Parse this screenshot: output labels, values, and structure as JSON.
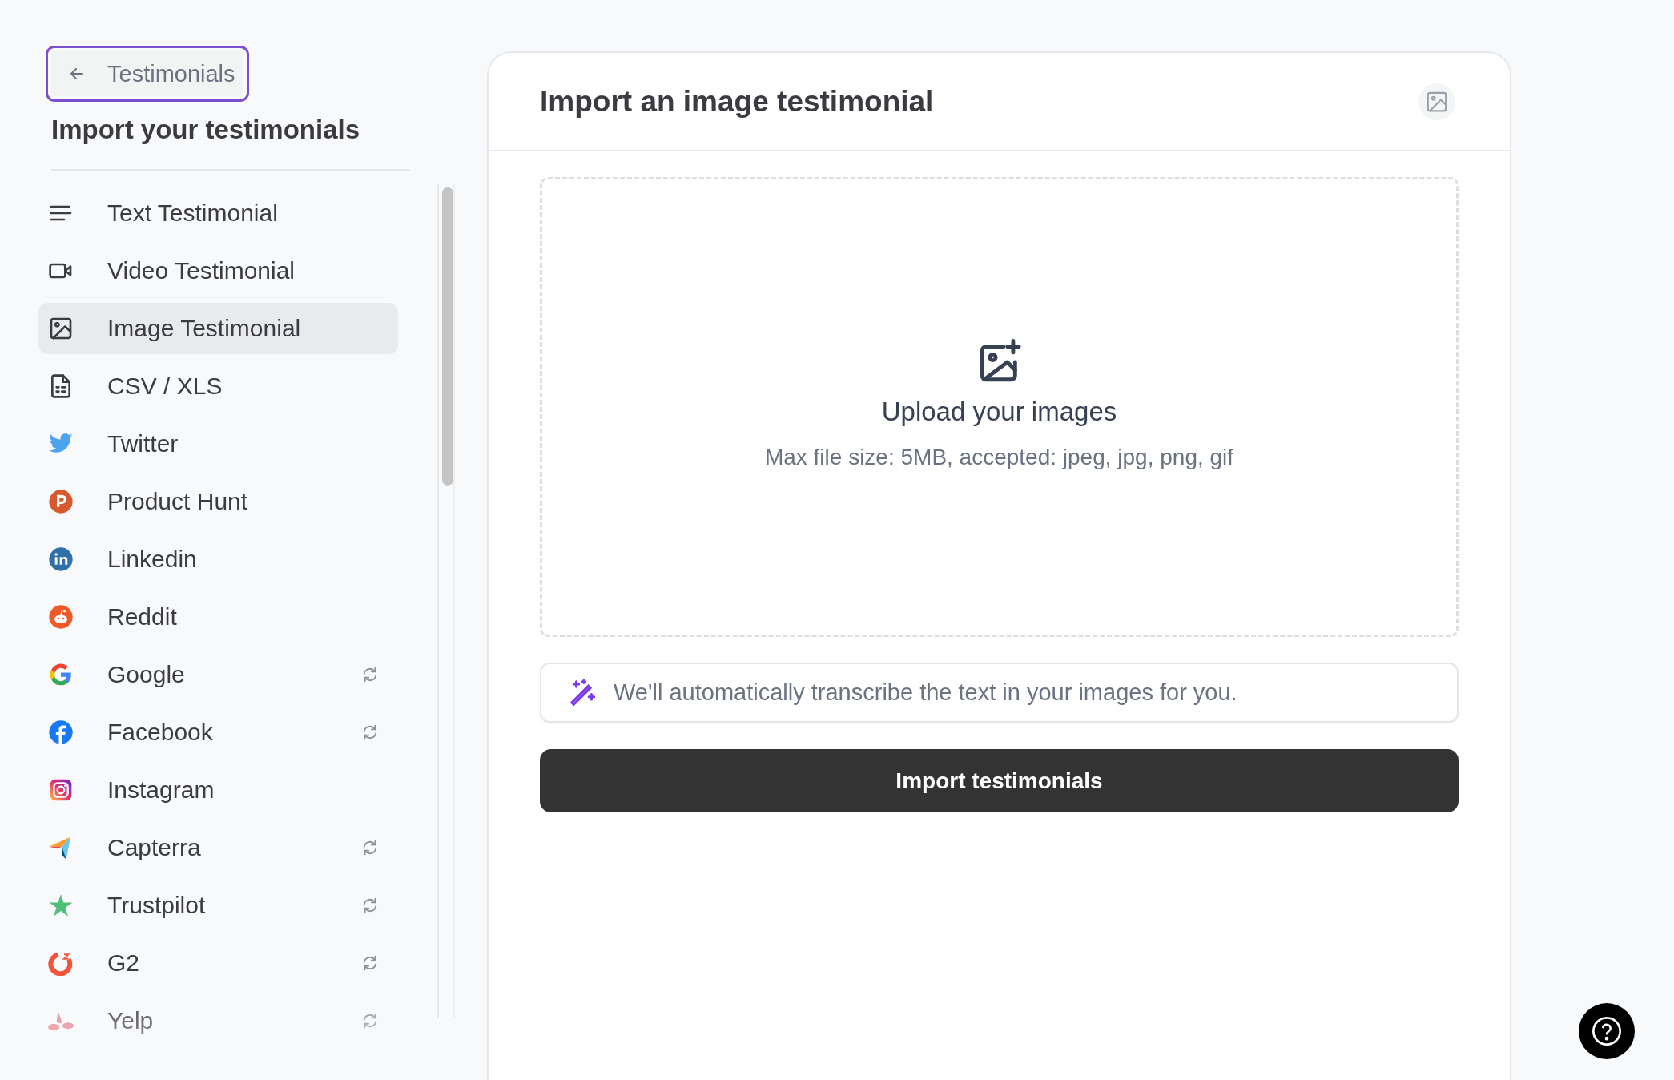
{
  "back_button": {
    "label": "Testimonials"
  },
  "sidebar": {
    "title": "Import your testimonials",
    "items": [
      {
        "label": "Text Testimonial",
        "selected": false,
        "sync": false
      },
      {
        "label": "Video Testimonial",
        "selected": false,
        "sync": false
      },
      {
        "label": "Image Testimonial",
        "selected": true,
        "sync": false
      },
      {
        "label": "CSV / XLS",
        "selected": false,
        "sync": false
      },
      {
        "label": "Twitter",
        "selected": false,
        "sync": false
      },
      {
        "label": "Product Hunt",
        "selected": false,
        "sync": false
      },
      {
        "label": "Linkedin",
        "selected": false,
        "sync": false
      },
      {
        "label": "Reddit",
        "selected": false,
        "sync": false
      },
      {
        "label": "Google",
        "selected": false,
        "sync": true
      },
      {
        "label": "Facebook",
        "selected": false,
        "sync": true
      },
      {
        "label": "Instagram",
        "selected": false,
        "sync": false
      },
      {
        "label": "Capterra",
        "selected": false,
        "sync": true
      },
      {
        "label": "Trustpilot",
        "selected": false,
        "sync": true
      },
      {
        "label": "G2",
        "selected": false,
        "sync": true
      },
      {
        "label": "Yelp",
        "selected": false,
        "sync": true
      }
    ]
  },
  "panel": {
    "title": "Import an image testimonial",
    "dropzone": {
      "title": "Upload your images",
      "hint": "Max file size: 5MB, accepted: jpeg, jpg, png, gif"
    },
    "note": "We'll automatically transcribe the text in your images for you.",
    "button": "Import testimonials"
  }
}
